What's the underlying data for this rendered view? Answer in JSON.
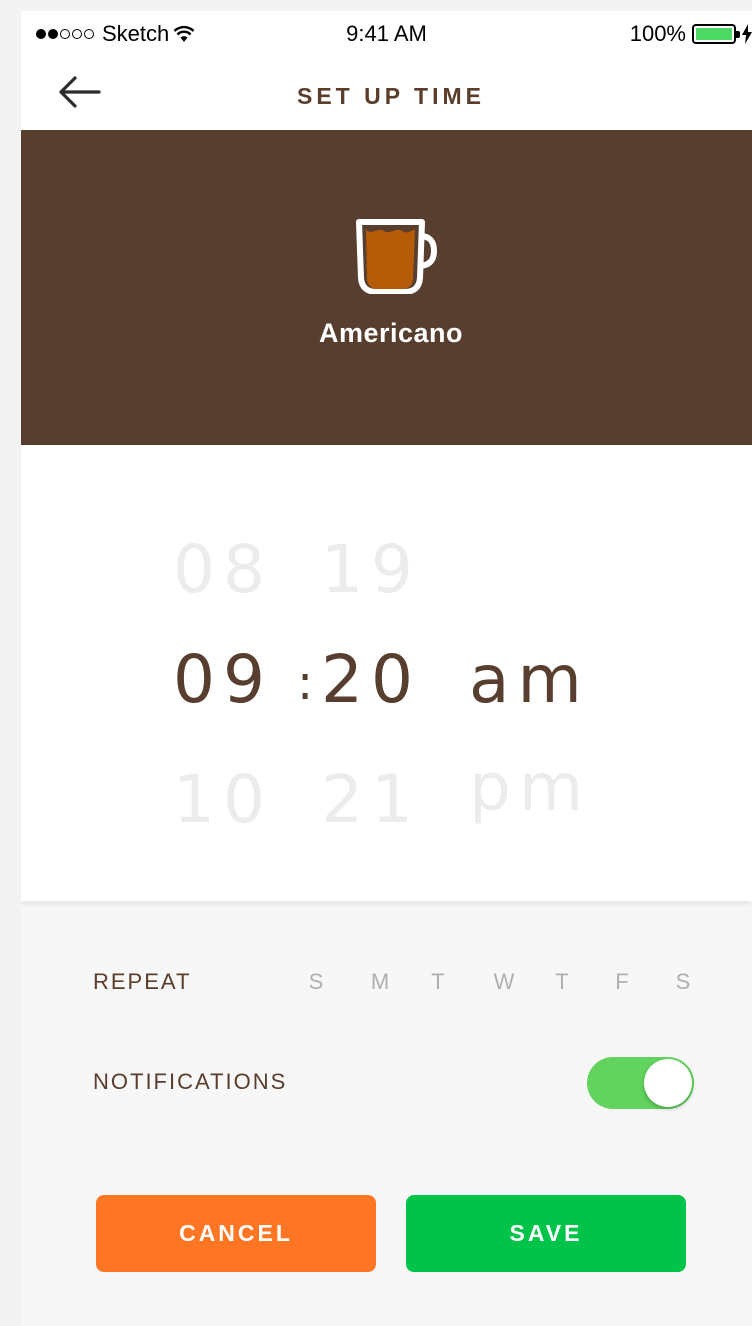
{
  "status_bar": {
    "carrier": "Sketch",
    "time": "9:41 AM",
    "battery": "100%",
    "signal_dots_filled": 2,
    "signal_dots_total": 5,
    "battery_fill_color": "#4cd964"
  },
  "nav": {
    "title": "SET UP TIME",
    "back_icon": "arrow-left-icon"
  },
  "hero": {
    "drink": "Americano",
    "icon": "coffee-cup-icon",
    "background": "#573e2f"
  },
  "time_picker": {
    "previous": {
      "hour": "08",
      "minute": "19",
      "period": ""
    },
    "selected": {
      "hour": "09",
      "separator": ":",
      "minute": "20",
      "period": "am"
    },
    "next": {
      "hour": "10",
      "minute": "21",
      "period": "pm"
    }
  },
  "repeat": {
    "label": "REPEAT",
    "days": [
      "S",
      "M",
      "T",
      "W",
      "T",
      "F",
      "S"
    ]
  },
  "notifications": {
    "label": "NOTIFICATIONS",
    "enabled": true,
    "toggle_color": "#62d35e"
  },
  "buttons": {
    "cancel": "CANCEL",
    "save": "SAVE",
    "cancel_color": "#fe7523",
    "save_color": "#00c44a"
  }
}
